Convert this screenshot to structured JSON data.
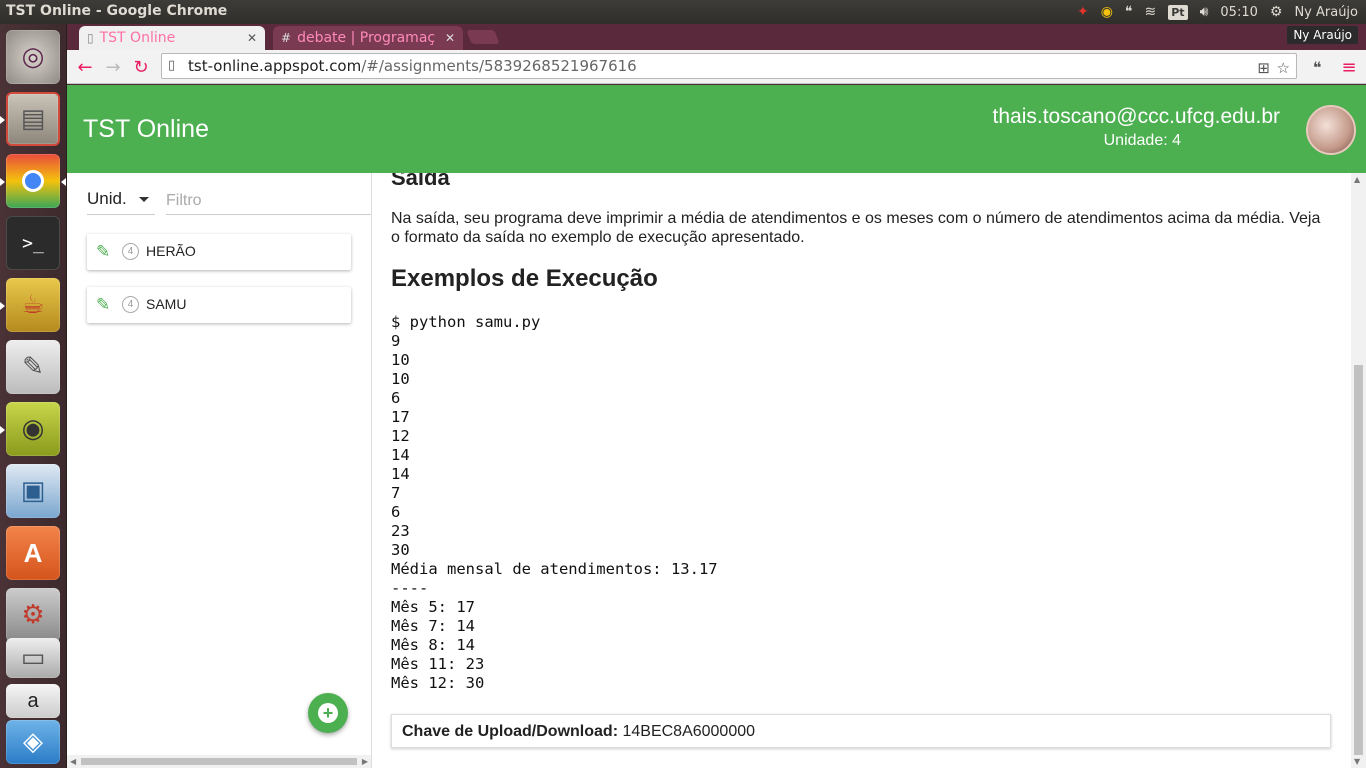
{
  "os": {
    "window_title": "TST Online - Google Chrome",
    "keyboard_layout": "Pt",
    "clock": "05:10",
    "user_name": "Ny Araújo"
  },
  "launcher": {
    "apps": [
      "ubuntu-dash-icon",
      "files-icon",
      "chrome-icon",
      "terminal-icon",
      "teapot-icon",
      "text-editor-icon",
      "audio-player-icon",
      "image-viewer-icon",
      "software-center-icon",
      "system-settings-icon",
      "drive-icon",
      "amazon-icon",
      "layers-icon"
    ]
  },
  "browser": {
    "tabs": [
      {
        "label": "TST Online",
        "active": true
      },
      {
        "label": "debate | Programaç",
        "active": false
      }
    ],
    "profile_name": "Ny Araújo",
    "url_host": "tst-online.appspot.com",
    "url_path": "/#/assignments/5839268521967616"
  },
  "app": {
    "title": "TST Online",
    "user_email": "thais.toscano@ccc.ufcg.edu.br",
    "user_unit": "Unidade: 4",
    "accent_color": "#4caf50"
  },
  "sidebar": {
    "unit_select_value": "Unid.",
    "filter_placeholder": "Filtro",
    "assignments": [
      {
        "unit": "4",
        "label": "HERÃO"
      },
      {
        "unit": "4",
        "label": "SAMU"
      }
    ],
    "add_button_symbol": "+"
  },
  "content": {
    "section_title": "Saída",
    "section_text": "Na saída, seu programa deve imprimir a média de atendimentos e os meses com o número de atendimentos acima da média. Veja o formato da saída no exemplo de execução apresentado.",
    "examples_title": "Exemplos de Execução",
    "code": "$ python samu.py\n9\n10\n10\n6\n17\n12\n14\n14\n7\n6\n23\n30\nMédia mensal de atendimentos: 13.17\n----\nMês 5: 17\nMês 7: 14\nMês 8: 14\nMês 11: 23\nMês 12: 30",
    "upload_label": "Chave de Upload/Download:",
    "upload_key": "14BEC8A6000000"
  }
}
